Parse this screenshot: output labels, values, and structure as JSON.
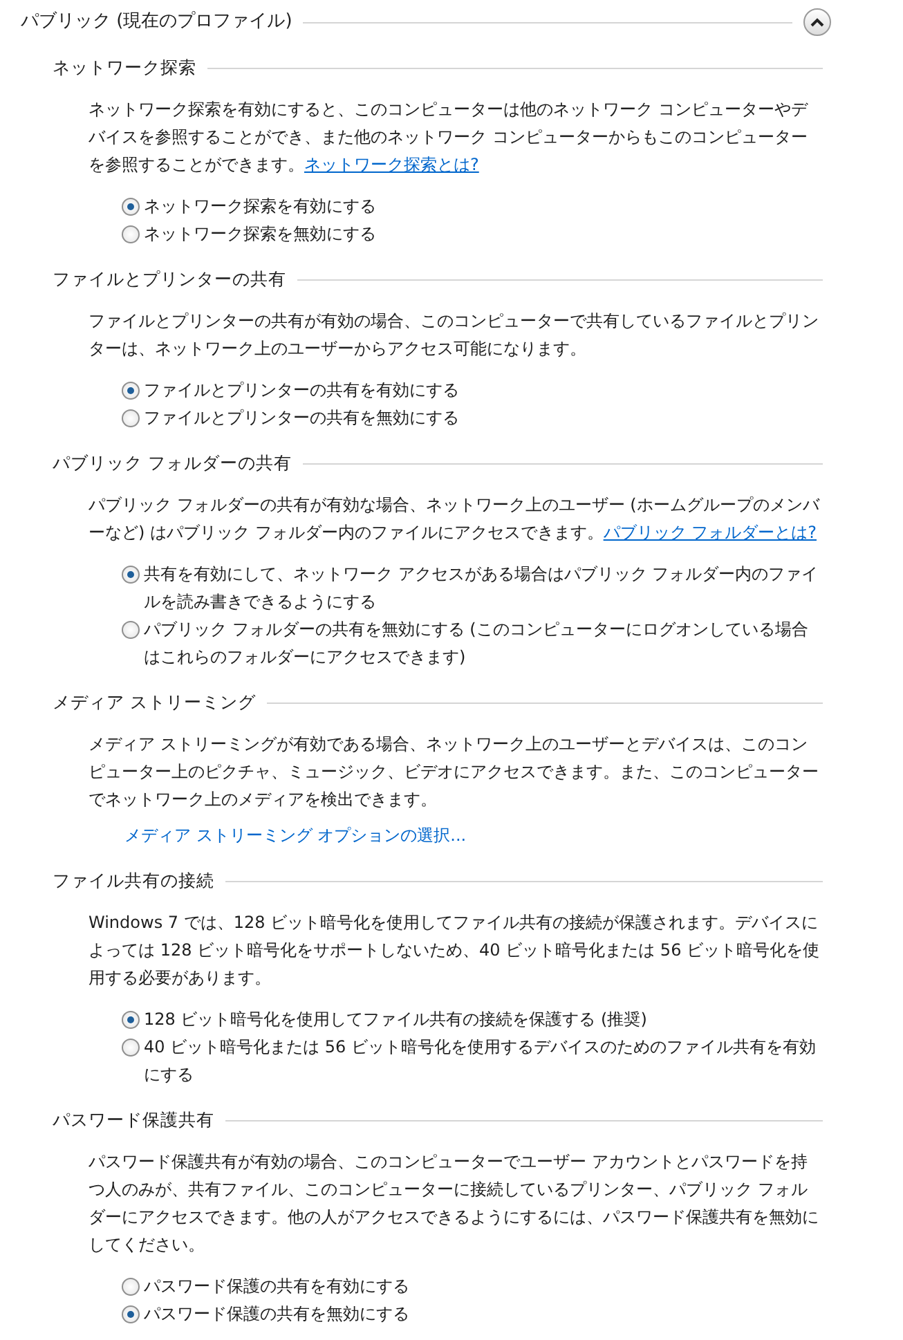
{
  "profile": {
    "title": "パブリック (現在のプロファイル)"
  },
  "sections": [
    {
      "title": "ネットワーク探索",
      "description": "ネットワーク探索を有効にすると、このコンピューターは他のネットワーク コンピューターやデバイスを参照することができ、また他のネットワーク コンピューターからもこのコンピューターを参照することができます。",
      "link": "ネットワーク探索とは?",
      "options": [
        {
          "label": "ネットワーク探索を有効にする",
          "selected": true
        },
        {
          "label": "ネットワーク探索を無効にする",
          "selected": false
        }
      ]
    },
    {
      "title": "ファイルとプリンターの共有",
      "description": "ファイルとプリンターの共有が有効の場合、このコンピューターで共有しているファイルとプリンターは、ネットワーク上のユーザーからアクセス可能になります。",
      "options": [
        {
          "label": "ファイルとプリンターの共有を有効にする",
          "selected": true
        },
        {
          "label": "ファイルとプリンターの共有を無効にする",
          "selected": false
        }
      ]
    },
    {
      "title": "パブリック フォルダーの共有",
      "description": "パブリック フォルダーの共有が有効な場合、ネットワーク上のユーザー (ホームグループのメンバーなど) はパブリック フォルダー内のファイルにアクセスできます。",
      "link": "パブリック フォルダーとは?",
      "options": [
        {
          "label": "共有を有効にして、ネットワーク アクセスがある場合はパブリック フォルダー内のファイルを読み書きできるようにする",
          "selected": true
        },
        {
          "label": "パブリック フォルダーの共有を無効にする (このコンピューターにログオンしている場合はこれらのフォルダーにアクセスできます)",
          "selected": false
        }
      ]
    },
    {
      "title": "メディア ストリーミング",
      "description": "メディア ストリーミングが有効である場合、ネットワーク上のユーザーとデバイスは、このコンピューター上のピクチャ、ミュージック、ビデオにアクセスできます。また、このコンピューターでネットワーク上のメディアを検出できます。",
      "action_link": "メディア ストリーミング オプションの選択..."
    },
    {
      "title": "ファイル共有の接続",
      "description": "Windows 7 では、128 ビット暗号化を使用してファイル共有の接続が保護されます。デバイスによっては 128 ビット暗号化をサポートしないため、40 ビット暗号化または 56 ビット暗号化を使用する必要があります。",
      "options": [
        {
          "label": "128 ビット暗号化を使用してファイル共有の接続を保護する (推奨)",
          "selected": true
        },
        {
          "label": "40 ビット暗号化または 56 ビット暗号化を使用するデバイスのためのファイル共有を有効にする",
          "selected": false
        }
      ]
    },
    {
      "title": "パスワード保護共有",
      "description": "パスワード保護共有が有効の場合、このコンピューターでユーザー アカウントとパスワードを持つ人のみが、共有ファイル、このコンピューターに接続しているプリンター、パブリック フォルダーにアクセスできます。他の人がアクセスできるようにするには、パスワード保護共有を無効にしてください。",
      "options": [
        {
          "label": "パスワード保護の共有を有効にする",
          "selected": false
        },
        {
          "label": "パスワード保護の共有を無効にする",
          "selected": true
        }
      ]
    }
  ]
}
